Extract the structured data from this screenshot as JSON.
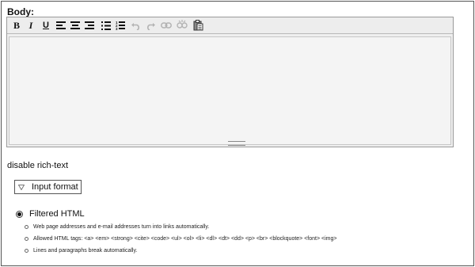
{
  "form": {
    "body_label": "Body:",
    "disable_link": "disable rich-text"
  },
  "toolbar": {
    "buttons": [
      {
        "name": "bold",
        "glyph": "B",
        "icon": "bold-icon",
        "enabled": true
      },
      {
        "name": "italic",
        "glyph": "I",
        "icon": "italic-icon",
        "enabled": true
      },
      {
        "name": "underline",
        "glyph": "U",
        "icon": "underline-icon",
        "enabled": true
      },
      {
        "name": "align-left",
        "icon": "align-left-icon",
        "enabled": true
      },
      {
        "name": "align-center",
        "icon": "align-center-icon",
        "enabled": true
      },
      {
        "name": "align-right",
        "icon": "align-right-icon",
        "enabled": true
      },
      {
        "name": "bullet-list",
        "icon": "bullet-list-icon",
        "enabled": true
      },
      {
        "name": "numbered-list",
        "icon": "numbered-list-icon",
        "enabled": true
      },
      {
        "name": "undo",
        "icon": "undo-icon",
        "enabled": false
      },
      {
        "name": "redo",
        "icon": "redo-icon",
        "enabled": false
      },
      {
        "name": "link",
        "icon": "link-icon",
        "enabled": false
      },
      {
        "name": "unlink",
        "icon": "unlink-icon",
        "enabled": false
      },
      {
        "name": "paste",
        "icon": "paste-icon",
        "enabled": true
      }
    ]
  },
  "input_format": {
    "legend": "Input format",
    "collapse_icon": "triangle-down-icon",
    "option": {
      "label": "Filtered HTML",
      "selected": true
    },
    "tips": [
      "Web page addresses and e-mail addresses turn into links automatically.",
      "Allowed HTML tags: <a> <em> <strong> <cite> <code> <ul> <ol> <li> <dl> <dt> <dd> <p> <br> <blockquote> <font> <img>",
      "Lines and paragraphs break automatically."
    ]
  },
  "colors": {
    "toolbar_bg": "#ededed",
    "editor_bg": "#efefef",
    "border": "#555555",
    "disabled_icon": "#b3b3b3"
  }
}
